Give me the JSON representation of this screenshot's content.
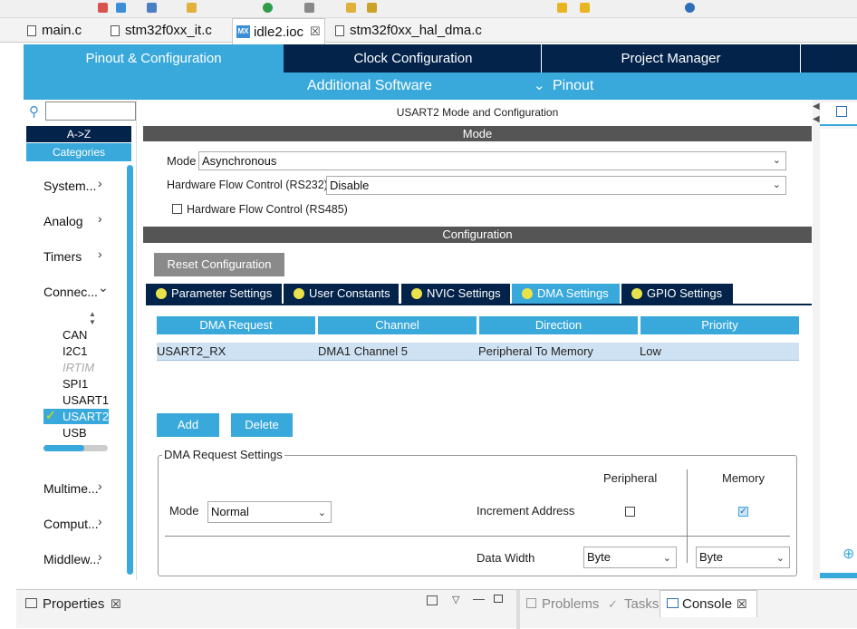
{
  "editor_tabs": [
    {
      "label": "main.c"
    },
    {
      "label": "stm32f0xx_it.c"
    },
    {
      "label": "idle2.ioc",
      "badge": "MX",
      "close": "☒"
    },
    {
      "label": "stm32f0xx_hal_dma.c"
    }
  ],
  "main_tabs": [
    "Pinout & Configuration",
    "Clock Configuration",
    "Project Manager"
  ],
  "sub_nav": {
    "additional_software": "Additional Software",
    "pinout": "Pinout"
  },
  "left_panel": {
    "search_placeholder": "",
    "sort_az": "A->Z",
    "categories_tab": "Categories",
    "categories": [
      "System...",
      "Analog",
      "Timers",
      "Connec...",
      "Multime...",
      "Comput...",
      "Middlew..."
    ],
    "peripherals": [
      "CAN",
      "I2C1",
      "IRTIM",
      "SPI1",
      "USART1",
      "USART2",
      "USB"
    ]
  },
  "mode_panel": {
    "title": "USART2 Mode and Configuration",
    "section": "Mode",
    "mode_label": "Mode",
    "mode_value": "Asynchronous",
    "flow_label": "Hardware Flow Control (RS232)",
    "flow_value": "Disable",
    "rs485_label": "Hardware Flow Control (RS485)"
  },
  "configuration": {
    "section": "Configuration",
    "reset_button": "Reset Configuration",
    "tabs": [
      "Parameter Settings",
      "User Constants",
      "NVIC Settings",
      "DMA Settings",
      "GPIO Settings"
    ],
    "table_headers": [
      "DMA Request",
      "Channel",
      "Direction",
      "Priority"
    ],
    "rows": [
      [
        "USART2_RX",
        "DMA1 Channel 5",
        "Peripheral To Memory",
        "Low"
      ]
    ],
    "add_button": "Add",
    "delete_button": "Delete"
  },
  "dma_request_settings": {
    "legend": "DMA Request Settings",
    "peripheral_col": "Peripheral",
    "memory_col": "Memory",
    "mode_label": "Mode",
    "mode_value": "Normal",
    "increment_label": "Increment Address",
    "data_width_label": "Data Width",
    "peripheral_width": "Byte",
    "memory_width": "Byte"
  },
  "bottom": {
    "properties": "Properties",
    "problems": "Problems",
    "tasks": "Tasks",
    "console": "Console",
    "close": "☒"
  },
  "colors": {
    "navy": "#03234b",
    "accent": "#39a9dc",
    "header_gray": "#555555"
  }
}
